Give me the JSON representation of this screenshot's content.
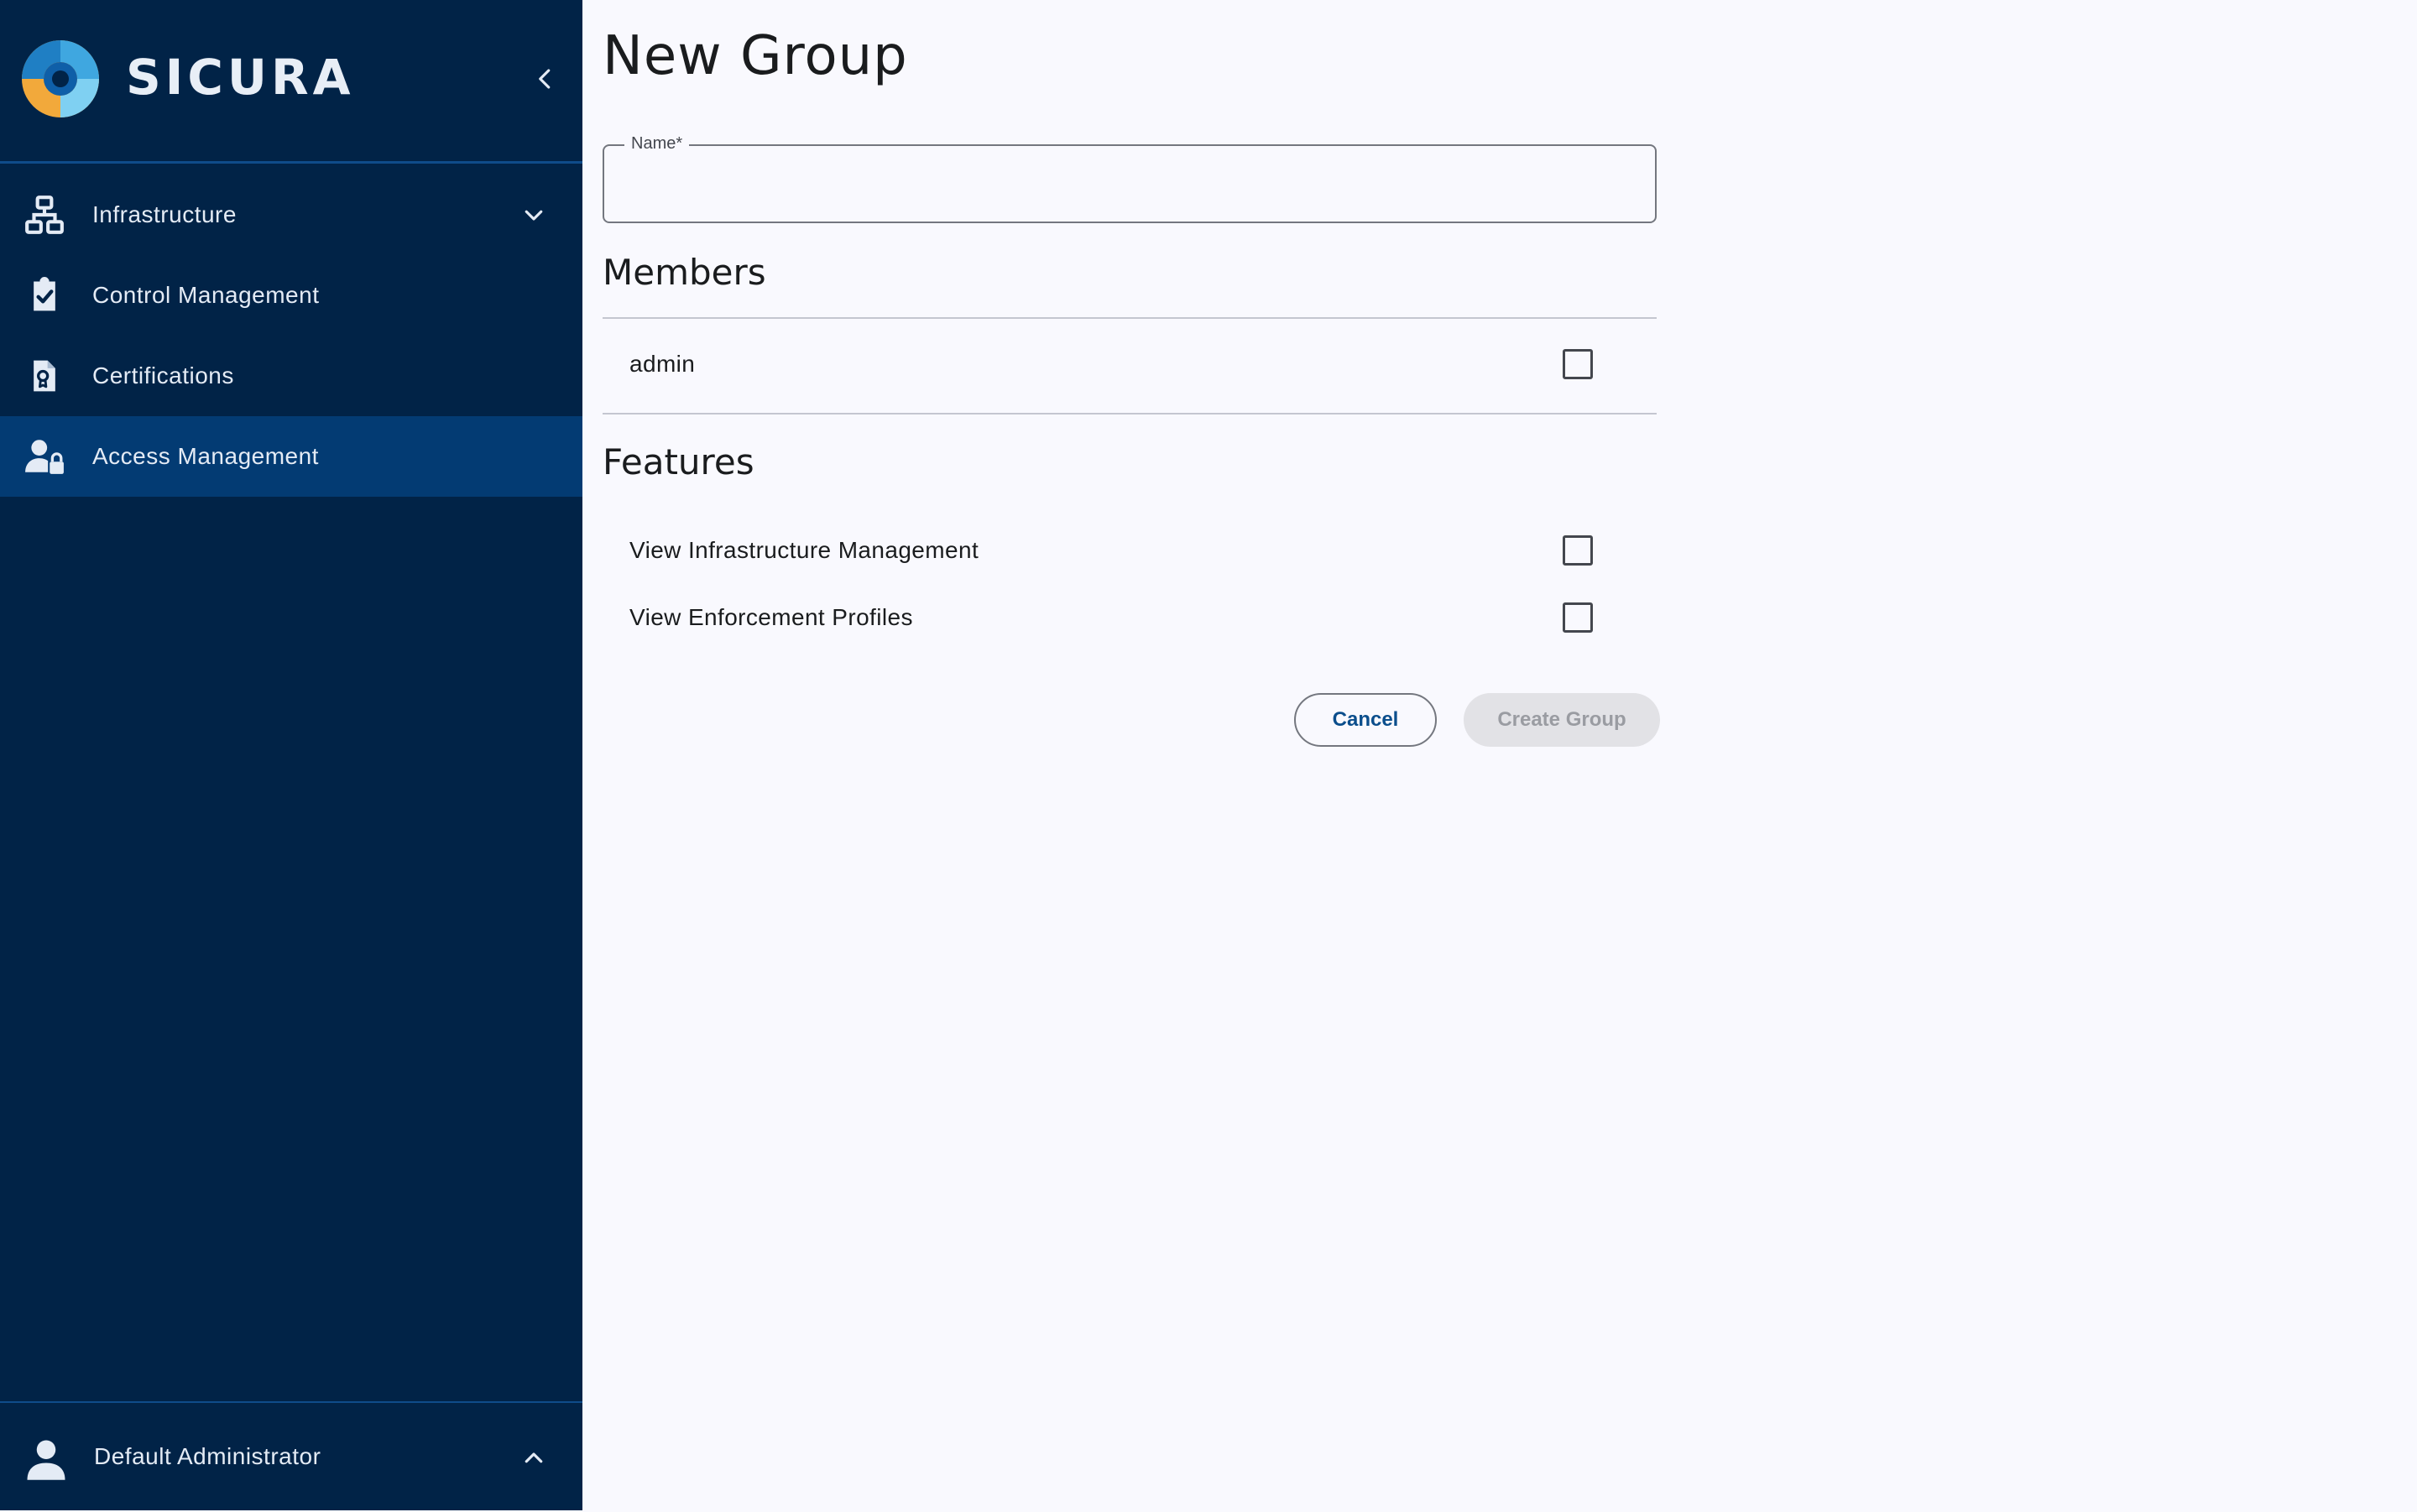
{
  "brand": {
    "name": "SICURA",
    "logo_icon": "sicura-logo-icon"
  },
  "sidebar": {
    "collapse_icon": "chevron-left-icon",
    "items": [
      {
        "label": "Infrastructure",
        "icon": "network-icon",
        "expandable": true,
        "expand_icon": "chevron-down-icon",
        "active": false
      },
      {
        "label": "Control Management",
        "icon": "clipboard-check-icon",
        "active": false
      },
      {
        "label": "Certifications",
        "icon": "certificate-document-icon",
        "active": false
      },
      {
        "label": "Access Management",
        "icon": "user-lock-icon",
        "active": true
      }
    ],
    "user": {
      "label": "Default Administrator",
      "icon": "person-icon",
      "expand_icon": "chevron-up-icon"
    }
  },
  "main": {
    "title": "New Group",
    "name_field": {
      "label": "Name*",
      "value": "",
      "placeholder": ""
    },
    "members": {
      "title": "Members",
      "items": [
        {
          "label": "admin",
          "checked": false
        }
      ]
    },
    "features": {
      "title": "Features",
      "items": [
        {
          "label": "View Infrastructure Management",
          "checked": false
        },
        {
          "label": "View Enforcement Profiles",
          "checked": false
        }
      ]
    },
    "actions": {
      "cancel_label": "Cancel",
      "create_label": "Create Group",
      "create_disabled": true
    }
  },
  "colors": {
    "sidebar_bg": "#012347",
    "sidebar_active_bg": "#033b73",
    "page_bg": "#f9f9fe",
    "accent": "#0b4e8c",
    "disabled_button_bg": "#e2e2e6"
  }
}
